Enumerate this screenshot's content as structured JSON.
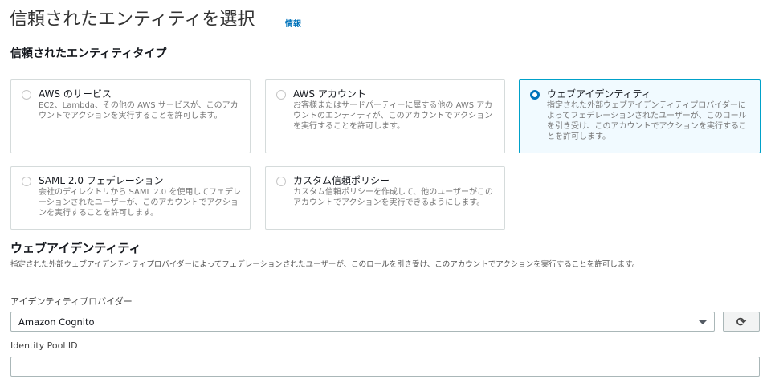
{
  "header": {
    "title": "信頼されたエンティティを選択",
    "info_link": "情報"
  },
  "entity_type": {
    "heading": "信頼されたエンティティタイプ",
    "options": [
      {
        "label": "AWS のサービス",
        "description": "EC2、Lambda、その他の AWS サービスが、このアカウントでアクションを実行することを許可します。",
        "selected": false
      },
      {
        "label": "AWS アカウント",
        "description": "お客様またはサードパーティーに属する他の AWS アカウントのエンティティが、このアカウントでアクションを実行することを許可します。",
        "selected": false
      },
      {
        "label": "ウェブアイデンティティ",
        "description": "指定された外部ウェブアイデンティティプロバイダーによってフェデレーションされたユーザーが、このロールを引き受け、このアカウントでアクションを実行することを許可します。",
        "selected": true
      },
      {
        "label": "SAML 2.0 フェデレーション",
        "description": "会社のディレクトリから SAML 2.0 を使用してフェデレーションされたユーザーが、このアカウントでアクションを実行することを許可します。",
        "selected": false
      },
      {
        "label": "カスタム信頼ポリシー",
        "description": "カスタム信頼ポリシーを作成して、他のユーザーがこのアカウントでアクションを実行できるようにします。",
        "selected": false
      }
    ]
  },
  "web_identity": {
    "heading": "ウェブアイデンティティ",
    "description": "指定された外部ウェブアイデンティティプロバイダーによってフェデレーションされたユーザーが、このロールを引き受け、このアカウントでアクションを実行することを許可します。",
    "provider_label": "アイデンティティプロバイダー",
    "provider_value": "Amazon Cognito",
    "refresh_icon": "⟳",
    "pool_label": "Identity Pool ID",
    "pool_value": ""
  }
}
